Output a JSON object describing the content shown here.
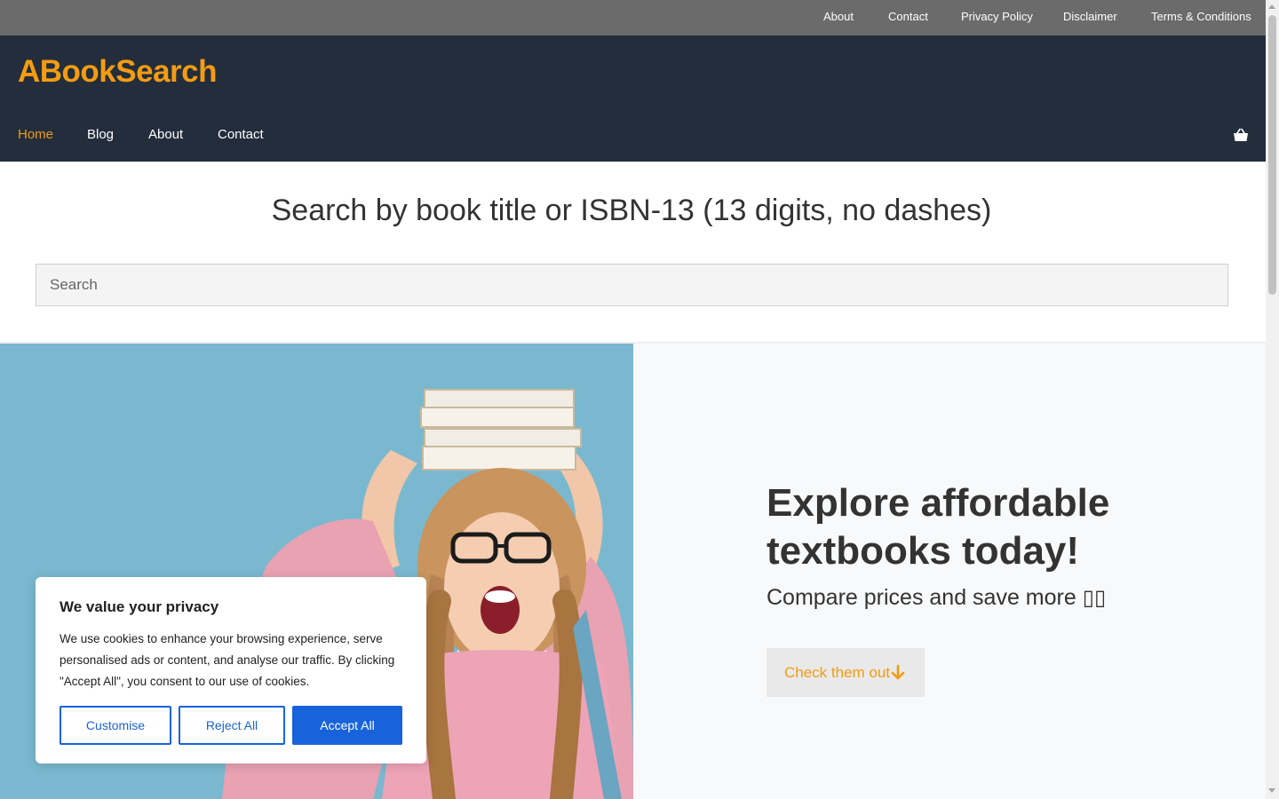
{
  "topbar": {
    "links": [
      "About",
      "Contact",
      "Privacy Policy",
      "Disclaimer",
      "Terms & Conditions"
    ]
  },
  "header": {
    "logo": "ABookSearch",
    "nav": [
      "Home",
      "Blog",
      "About",
      "Contact"
    ],
    "active_nav": "Home",
    "cart_icon": "shopping-basket-icon"
  },
  "search": {
    "title": "Search by book title or ISBN-13 (13 digits, no dashes)",
    "placeholder": "Search"
  },
  "hero": {
    "title": "Explore affordable textbooks today!",
    "subtitle": "Compare prices and save more",
    "subtitle_emoji": "▯▯",
    "button_label": "Check them out",
    "button_icon": "arrow-down-icon"
  },
  "cookie": {
    "title": "We value your privacy",
    "text": "We use cookies to enhance your browsing experience, serve personalised ads or content, and analyse our traffic. By clicking \"Accept All\", you consent to our use of cookies.",
    "buttons": {
      "customise": "Customise",
      "reject": "Reject All",
      "accept": "Accept All"
    }
  },
  "colors": {
    "brand_orange": "#f39c12",
    "header_bg": "#232d3c",
    "topbar_bg": "#6b6b6b",
    "consent_blue": "#1863dc"
  }
}
